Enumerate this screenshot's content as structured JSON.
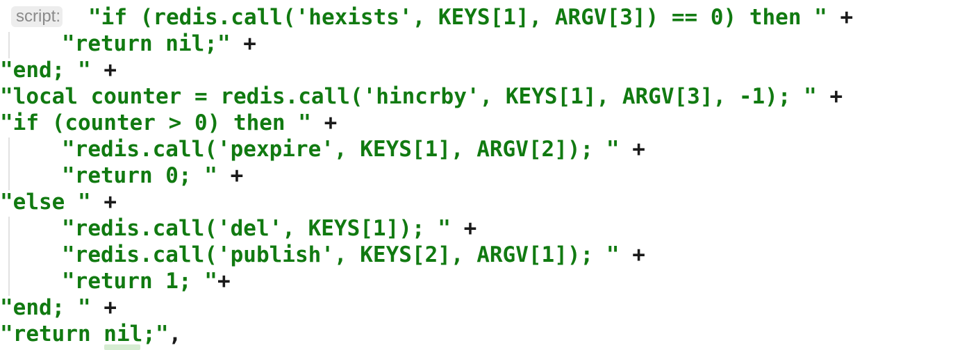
{
  "editor": {
    "param_hint": "script:",
    "lines": [
      {
        "code": "\"if (redis.call('hexists', KEYS[1], ARGV[3]) == 0) then \"",
        "op": " +",
        "indent": false
      },
      {
        "code": "\"return nil;\"",
        "op": " +",
        "indent": true
      },
      {
        "code": "\"end; \"",
        "op": " +",
        "indent": false
      },
      {
        "code": "\"local counter = redis.call('hincrby', KEYS[1], ARGV[3], -1); \"",
        "op": " +",
        "indent": false
      },
      {
        "code": "\"if (counter > 0) then \"",
        "op": " +",
        "indent": false
      },
      {
        "code": "\"redis.call('pexpire', KEYS[1], ARGV[2]); \"",
        "op": " +",
        "indent": true
      },
      {
        "code": "\"return 0; \"",
        "op": " +",
        "indent": true
      },
      {
        "code": "\"else \"",
        "op": " +",
        "indent": false
      },
      {
        "code": "\"redis.call('del', KEYS[1]); \"",
        "op": " +",
        "indent": true
      },
      {
        "code": "\"redis.call('publish', KEYS[2], ARGV[1]); \"",
        "op": " +",
        "indent": true
      },
      {
        "code": "\"return 1; \"",
        "op": "+",
        "indent": true
      },
      {
        "code": "\"end; \"",
        "op": " +",
        "indent": false
      },
      {
        "code": "\"return nil;\"",
        "op": ",",
        "indent": false
      }
    ]
  },
  "colors": {
    "string": "#117a11",
    "operator": "#1a1a1a",
    "hint_background": "#ededed",
    "hint_text": "#8a8a8a",
    "indent_guide": "#e1e1e1",
    "background": "#ffffff"
  }
}
